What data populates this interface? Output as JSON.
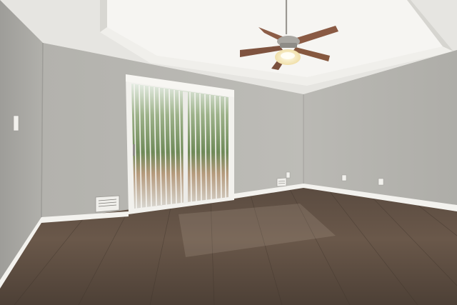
{
  "scene": {
    "subject": "empty-room",
    "elements": [
      "tray-ceiling",
      "ceiling-fan",
      "sliding-glass-door",
      "vertical-blinds",
      "floor-vent",
      "wall-outlet",
      "light-switch",
      "baseboard",
      "hardwood-floor"
    ]
  },
  "palette": {
    "ceiling": "#e9e8e4",
    "wall_left": "#a9a8a4",
    "wall_back": "#b7b6b1",
    "wall_right": "#b4b3ae",
    "trim": "#f4f3ef",
    "floor": "#5e4f43",
    "floor_dark": "#4a3d33",
    "fan_blade": "#8a5a44",
    "foliage": "#6f8a58",
    "blind": "#f1f0ec"
  }
}
